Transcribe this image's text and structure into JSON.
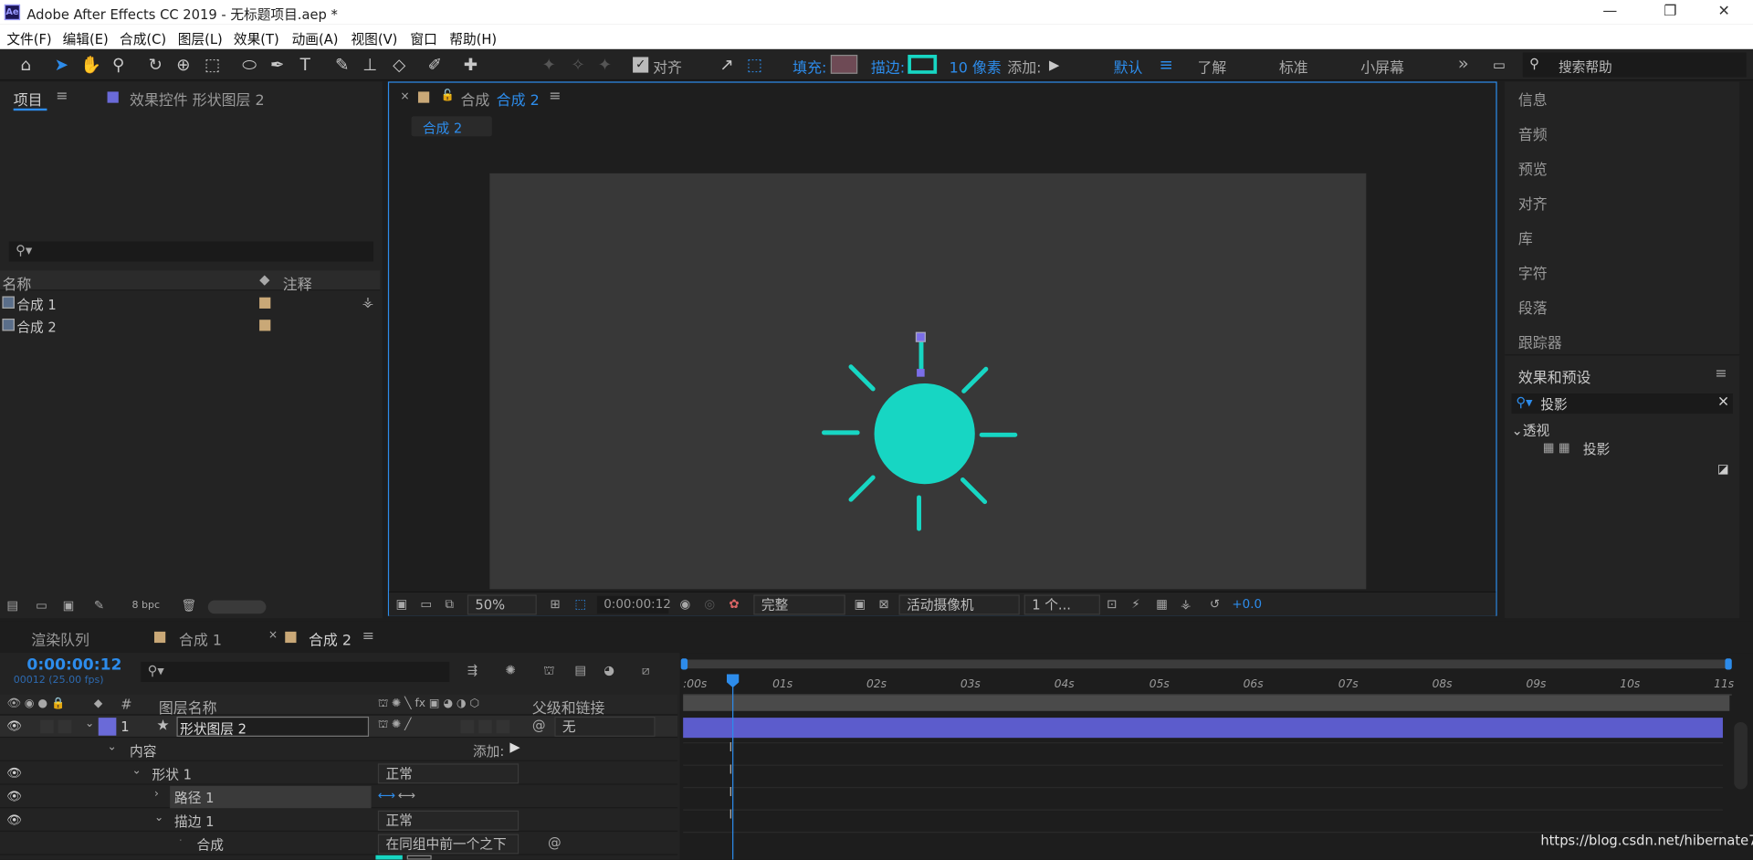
{
  "window": {
    "title": "Adobe After Effects CC 2019 - 无标题项目.aep *",
    "app_badge": "Ae"
  },
  "menu": [
    "文件(F)",
    "编辑(E)",
    "合成(C)",
    "图层(L)",
    "效果(T)",
    "动画(A)",
    "视图(V)",
    "窗口",
    "帮助(H)"
  ],
  "toolbar": {
    "align_label": "对齐",
    "fill_label": "填充:",
    "stroke_label": "描边:",
    "stroke_width": "10 像素",
    "add_label": "添加:",
    "workspaces": [
      "默认",
      "了解",
      "标准",
      "小屏幕"
    ],
    "more": "»",
    "search_placeholder": "搜索帮助",
    "colors": {
      "fill": "#6e4a55",
      "stroke": "#17d6c3",
      "accent": "#2d8ceb"
    }
  },
  "project_panel": {
    "tab_project": "项目",
    "tab_effects": "效果控件 形状图层 2",
    "col_name": "名称",
    "col_comment": "注释",
    "items": [
      {
        "name": "合成 1"
      },
      {
        "name": "合成 2"
      }
    ],
    "bpc": "8 bpc"
  },
  "comp_panel": {
    "tab_prefix": "合成",
    "tab_name": "合成 2",
    "sub_tab": "合成 2",
    "zoom": "50%",
    "timecode": "0:00:00:12",
    "resolution": "完整",
    "camera": "活动摄像机",
    "views": "1 个...",
    "exposure": "+0.0",
    "shape_color": "#17d6c3"
  },
  "right_panel": {
    "items": [
      "信息",
      "音频",
      "预览",
      "对齐",
      "库",
      "字符",
      "段落",
      "跟踪器"
    ],
    "effects_title": "效果和预设",
    "effects_search": "投影",
    "tree_folder": "透视",
    "tree_item": "投影"
  },
  "timeline": {
    "tabs": [
      "渲染队列",
      "合成 1",
      "合成 2"
    ],
    "timecode": "0:00:00:12",
    "frames": "00012 (25.00 fps)",
    "col_layer_name": "图层名称",
    "col_parent": "父级和链接",
    "col_num": "#",
    "layer": {
      "num": "1",
      "name": "形状图层 2",
      "parent": "无"
    },
    "rows": {
      "contents": "内容",
      "add": "添加:",
      "shape": "形状 1",
      "shape_mode": "正常",
      "path": "路径 1",
      "stroke": "描边 1",
      "stroke_mode": "正常",
      "composite": "合成",
      "composite_value": "在同组中前一个之下"
    },
    "ruler": [
      ":00s",
      "01s",
      "02s",
      "03s",
      "04s",
      "05s",
      "06s",
      "07s",
      "08s",
      "09s",
      "10s",
      "11s"
    ]
  },
  "watermark": "https://blog.csdn.net/hibernate7"
}
